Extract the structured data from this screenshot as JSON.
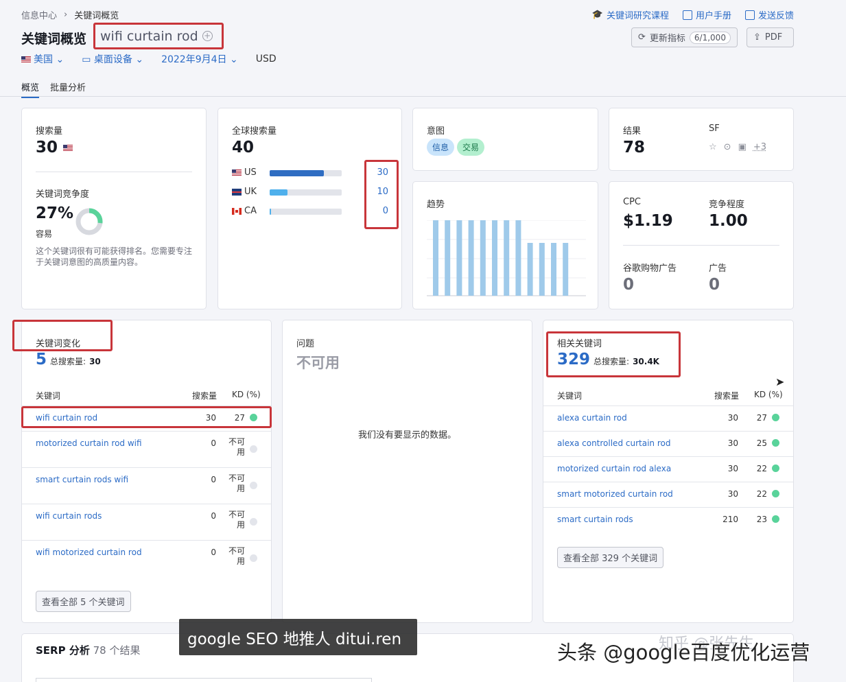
{
  "breadcrumb": [
    "信息中心",
    "关键词概览"
  ],
  "toplinks": [
    "关键词研究课程",
    "用户手册",
    "发送反馈"
  ],
  "title": "关键词概览",
  "keyword": "wifi curtain rod",
  "buttons": {
    "update": "更新指标",
    "update_count": "6/1,000",
    "pdf": "PDF"
  },
  "filters": {
    "country": "美国",
    "device": "桌面设备",
    "date": "2022年9月4日",
    "currency": "USD"
  },
  "tabs": [
    "概览",
    "批量分析"
  ],
  "volume": {
    "label": "搜索量",
    "value": "30"
  },
  "kd": {
    "label": "关键词竞争度",
    "value": "27%",
    "level": "容易",
    "percent": 27,
    "desc": "这个关键词很有可能获得排名。您需要专注于关键词意图的高质量内容。"
  },
  "global": {
    "label": "全球搜索量",
    "value": "40",
    "rows": [
      {
        "country": "US",
        "value": "30",
        "fraction": 0.75,
        "color": "#2f6dc2"
      },
      {
        "country": "UK",
        "value": "10",
        "fraction": 0.25,
        "color": "#4fb0ec"
      },
      {
        "country": "CA",
        "value": "0",
        "fraction": 0.02,
        "color": "#4fb0ec"
      }
    ]
  },
  "intent": {
    "label": "意图",
    "tags": [
      "信息",
      "交易"
    ]
  },
  "results": {
    "label": "结果",
    "value": "78",
    "sf_label": "SF",
    "sf_more": "+3"
  },
  "trend": {
    "label": "趋势",
    "values": [
      1,
      1,
      1,
      1,
      1,
      1,
      1,
      1,
      0.7,
      0.7,
      0.7,
      0.7
    ]
  },
  "cpc": {
    "label": "CPC",
    "value": "$1.19",
    "comp_label": "竞争程度",
    "comp_value": "1.00",
    "shop_label": "谷歌购物广告",
    "shop_value": "0",
    "ads_label": "广告",
    "ads_value": "0"
  },
  "variations": {
    "label": "关键词变化",
    "count": "5",
    "total_label": "总搜索量:",
    "total": "30",
    "col_kw": "关键词",
    "col_vol": "搜索量",
    "col_kd": "KD (%)",
    "rows": [
      {
        "kw": "wifi curtain rod",
        "vol": "30",
        "kd": "27"
      },
      {
        "kw": "motorized curtain rod wifi",
        "vol": "0",
        "kd": "不可用"
      },
      {
        "kw": "smart curtain rods wifi",
        "vol": "0",
        "kd": "不可用"
      },
      {
        "kw": "wifi curtain rods",
        "vol": "0",
        "kd": "不可用"
      },
      {
        "kw": "wifi motorized curtain rod",
        "vol": "0",
        "kd": "不可用"
      }
    ],
    "view_all": "查看全部 5 个关键词"
  },
  "questions": {
    "label": "问题",
    "status": "不可用",
    "empty": "我们没有要显示的数据。"
  },
  "related": {
    "label": "相关关键词",
    "count": "329",
    "total_label": "总搜索量:",
    "total": "30.4K",
    "col_kw": "关键词",
    "col_vol": "搜索量",
    "col_kd": "KD (%)",
    "rows": [
      {
        "kw": "alexa curtain rod",
        "vol": "30",
        "kd": "27"
      },
      {
        "kw": "alexa controlled curtain rod",
        "vol": "30",
        "kd": "25"
      },
      {
        "kw": "motorized curtain rod alexa",
        "vol": "30",
        "kd": "22"
      },
      {
        "kw": "smart motorized curtain rod",
        "vol": "30",
        "kd": "22"
      },
      {
        "kw": "smart curtain rods",
        "vol": "210",
        "kd": "23"
      }
    ],
    "view_all": "查看全部 329 个关键词"
  },
  "serp": {
    "label": "SERP 分析",
    "count": "78 个结果"
  },
  "overlay_text": "google  SEO 地推人 ditui.ren",
  "watermark": "头条 @google百度优化运营",
  "watermark2": "知乎 @张先生"
}
